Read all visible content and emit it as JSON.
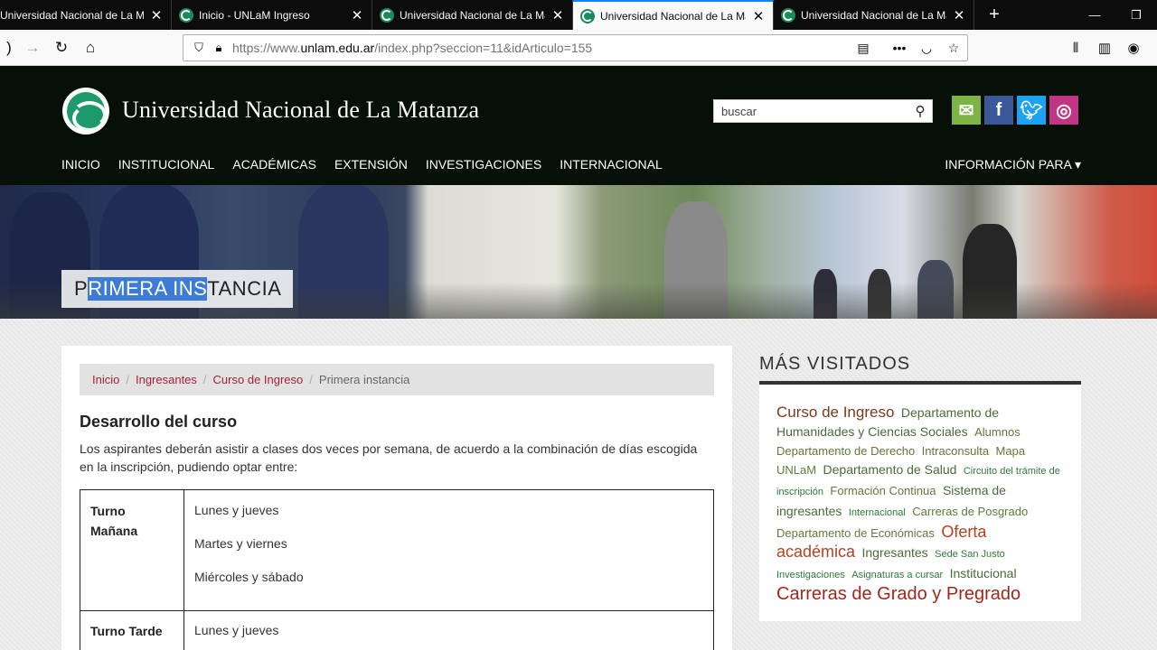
{
  "browser": {
    "tabs": [
      {
        "title": "Universidad Nacional de La Ma"
      },
      {
        "title": "Inicio - UNLaM Ingreso"
      },
      {
        "title": "Universidad Nacional de La Ma"
      },
      {
        "title": "Universidad Nacional de La Ma"
      },
      {
        "title": "Universidad Nacional de La Ma"
      }
    ],
    "url_prefix": "https://www.",
    "url_domain": "unlam.edu.ar",
    "url_path": "/index.php?seccion=11&idArticulo=155"
  },
  "site": {
    "name": "Universidad Nacional de La Matanza",
    "search_placeholder": "buscar",
    "menu": [
      "INICIO",
      "INSTITUCIONAL",
      "ACADÉMICAS",
      "EXTENSIÓN",
      "INVESTIGACIONES",
      "INTERNACIONAL"
    ],
    "info_para": "INFORMACIÓN PARA ▾",
    "colors": {
      "header_bg": "#061006",
      "accent": "#a2233a"
    }
  },
  "banner": {
    "title_pre": "P",
    "title_sel": "RIMERA INS",
    "title_post": "TANCIA"
  },
  "content": {
    "breadcrumb": [
      "Inicio",
      "Ingresantes",
      "Curso de Ingreso",
      "Primera instancia"
    ],
    "heading": "Desarrollo del curso",
    "paragraph": "Los aspirantes deberán asistir a clases dos veces por semana, de acuerdo a la combinación de días escogida en la inscripción, pudiendo optar entre:",
    "table": {
      "morning_label_1": "Turno",
      "morning_label_2": "Mañana",
      "morning_options": [
        "Lunes y jueves",
        "Martes y viernes",
        "Miércoles y sábado"
      ],
      "afternoon_label": "Turno Tarde",
      "afternoon_options": [
        "Lunes y jueves"
      ]
    }
  },
  "sidebar": {
    "heading": "MÁS VISITADOS",
    "tags": [
      {
        "text": "Curso de Ingreso",
        "size": "l"
      },
      {
        "text": "Departamento de Humanidades y Ciencias Sociales",
        "size": "ml"
      },
      {
        "text": "Alumnos",
        "size": "m"
      },
      {
        "text": "Departamento de Derecho",
        "size": "m"
      },
      {
        "text": "Intraconsulta",
        "size": "m"
      },
      {
        "text": "Mapa UNLaM",
        "size": "m"
      },
      {
        "text": "Departamento de Salud",
        "size": "ml"
      },
      {
        "text": "Circuito del trámite de inscripción",
        "size": "s"
      },
      {
        "text": "Formación Continua",
        "size": "m"
      },
      {
        "text": "Sistema de ingresantes",
        "size": "ml"
      },
      {
        "text": "Internacional",
        "size": "s"
      },
      {
        "text": "Carreras de Posgrado",
        "size": "m"
      },
      {
        "text": "Departamento de Económicas",
        "size": "m"
      },
      {
        "text": "Oferta académica",
        "size": "o"
      },
      {
        "text": "Ingresantes",
        "size": "ml"
      },
      {
        "text": "Sede San Justo",
        "size": "s"
      },
      {
        "text": "Investigaciones",
        "size": "s"
      },
      {
        "text": "Asignaturas a cursar",
        "size": "s"
      },
      {
        "text": "Institucional",
        "size": "ml"
      },
      {
        "text": "Carreras de Grado y Pregrado",
        "size": "xl"
      }
    ]
  }
}
